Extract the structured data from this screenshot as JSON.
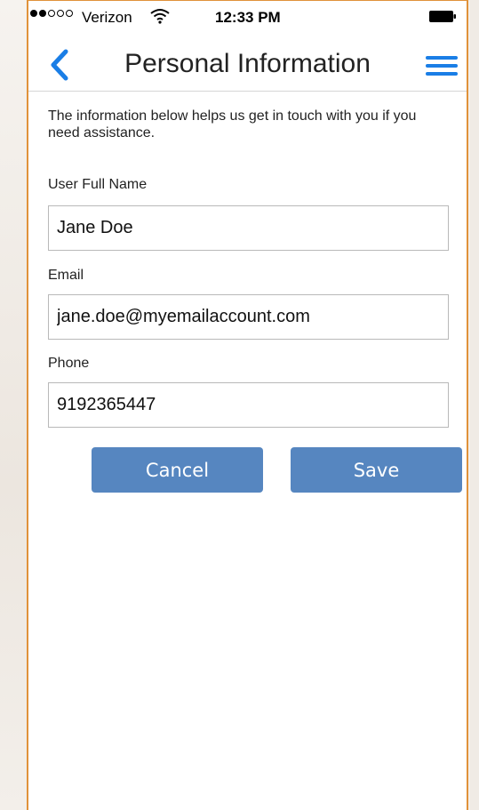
{
  "status_bar": {
    "carrier": "Verizon",
    "time": "12:33 PM",
    "signal_bars_filled": 2,
    "signal_bars_total": 5
  },
  "nav": {
    "title": "Personal Information",
    "back_icon": "chevron-left-icon",
    "menu_icon": "hamburger-menu-icon",
    "accent_color": "#1a7ee6"
  },
  "intro_text": "The information below helps us get in touch with you if you need assistance.",
  "form": {
    "full_name": {
      "label": "User Full Name",
      "value": "Jane Doe"
    },
    "email": {
      "label": "Email",
      "value": "jane.doe@myemailaccount.com"
    },
    "phone": {
      "label": "Phone",
      "value": "9192365447"
    }
  },
  "buttons": {
    "cancel_label": "Cancel",
    "save_label": "Save",
    "color": "#5686c0"
  }
}
